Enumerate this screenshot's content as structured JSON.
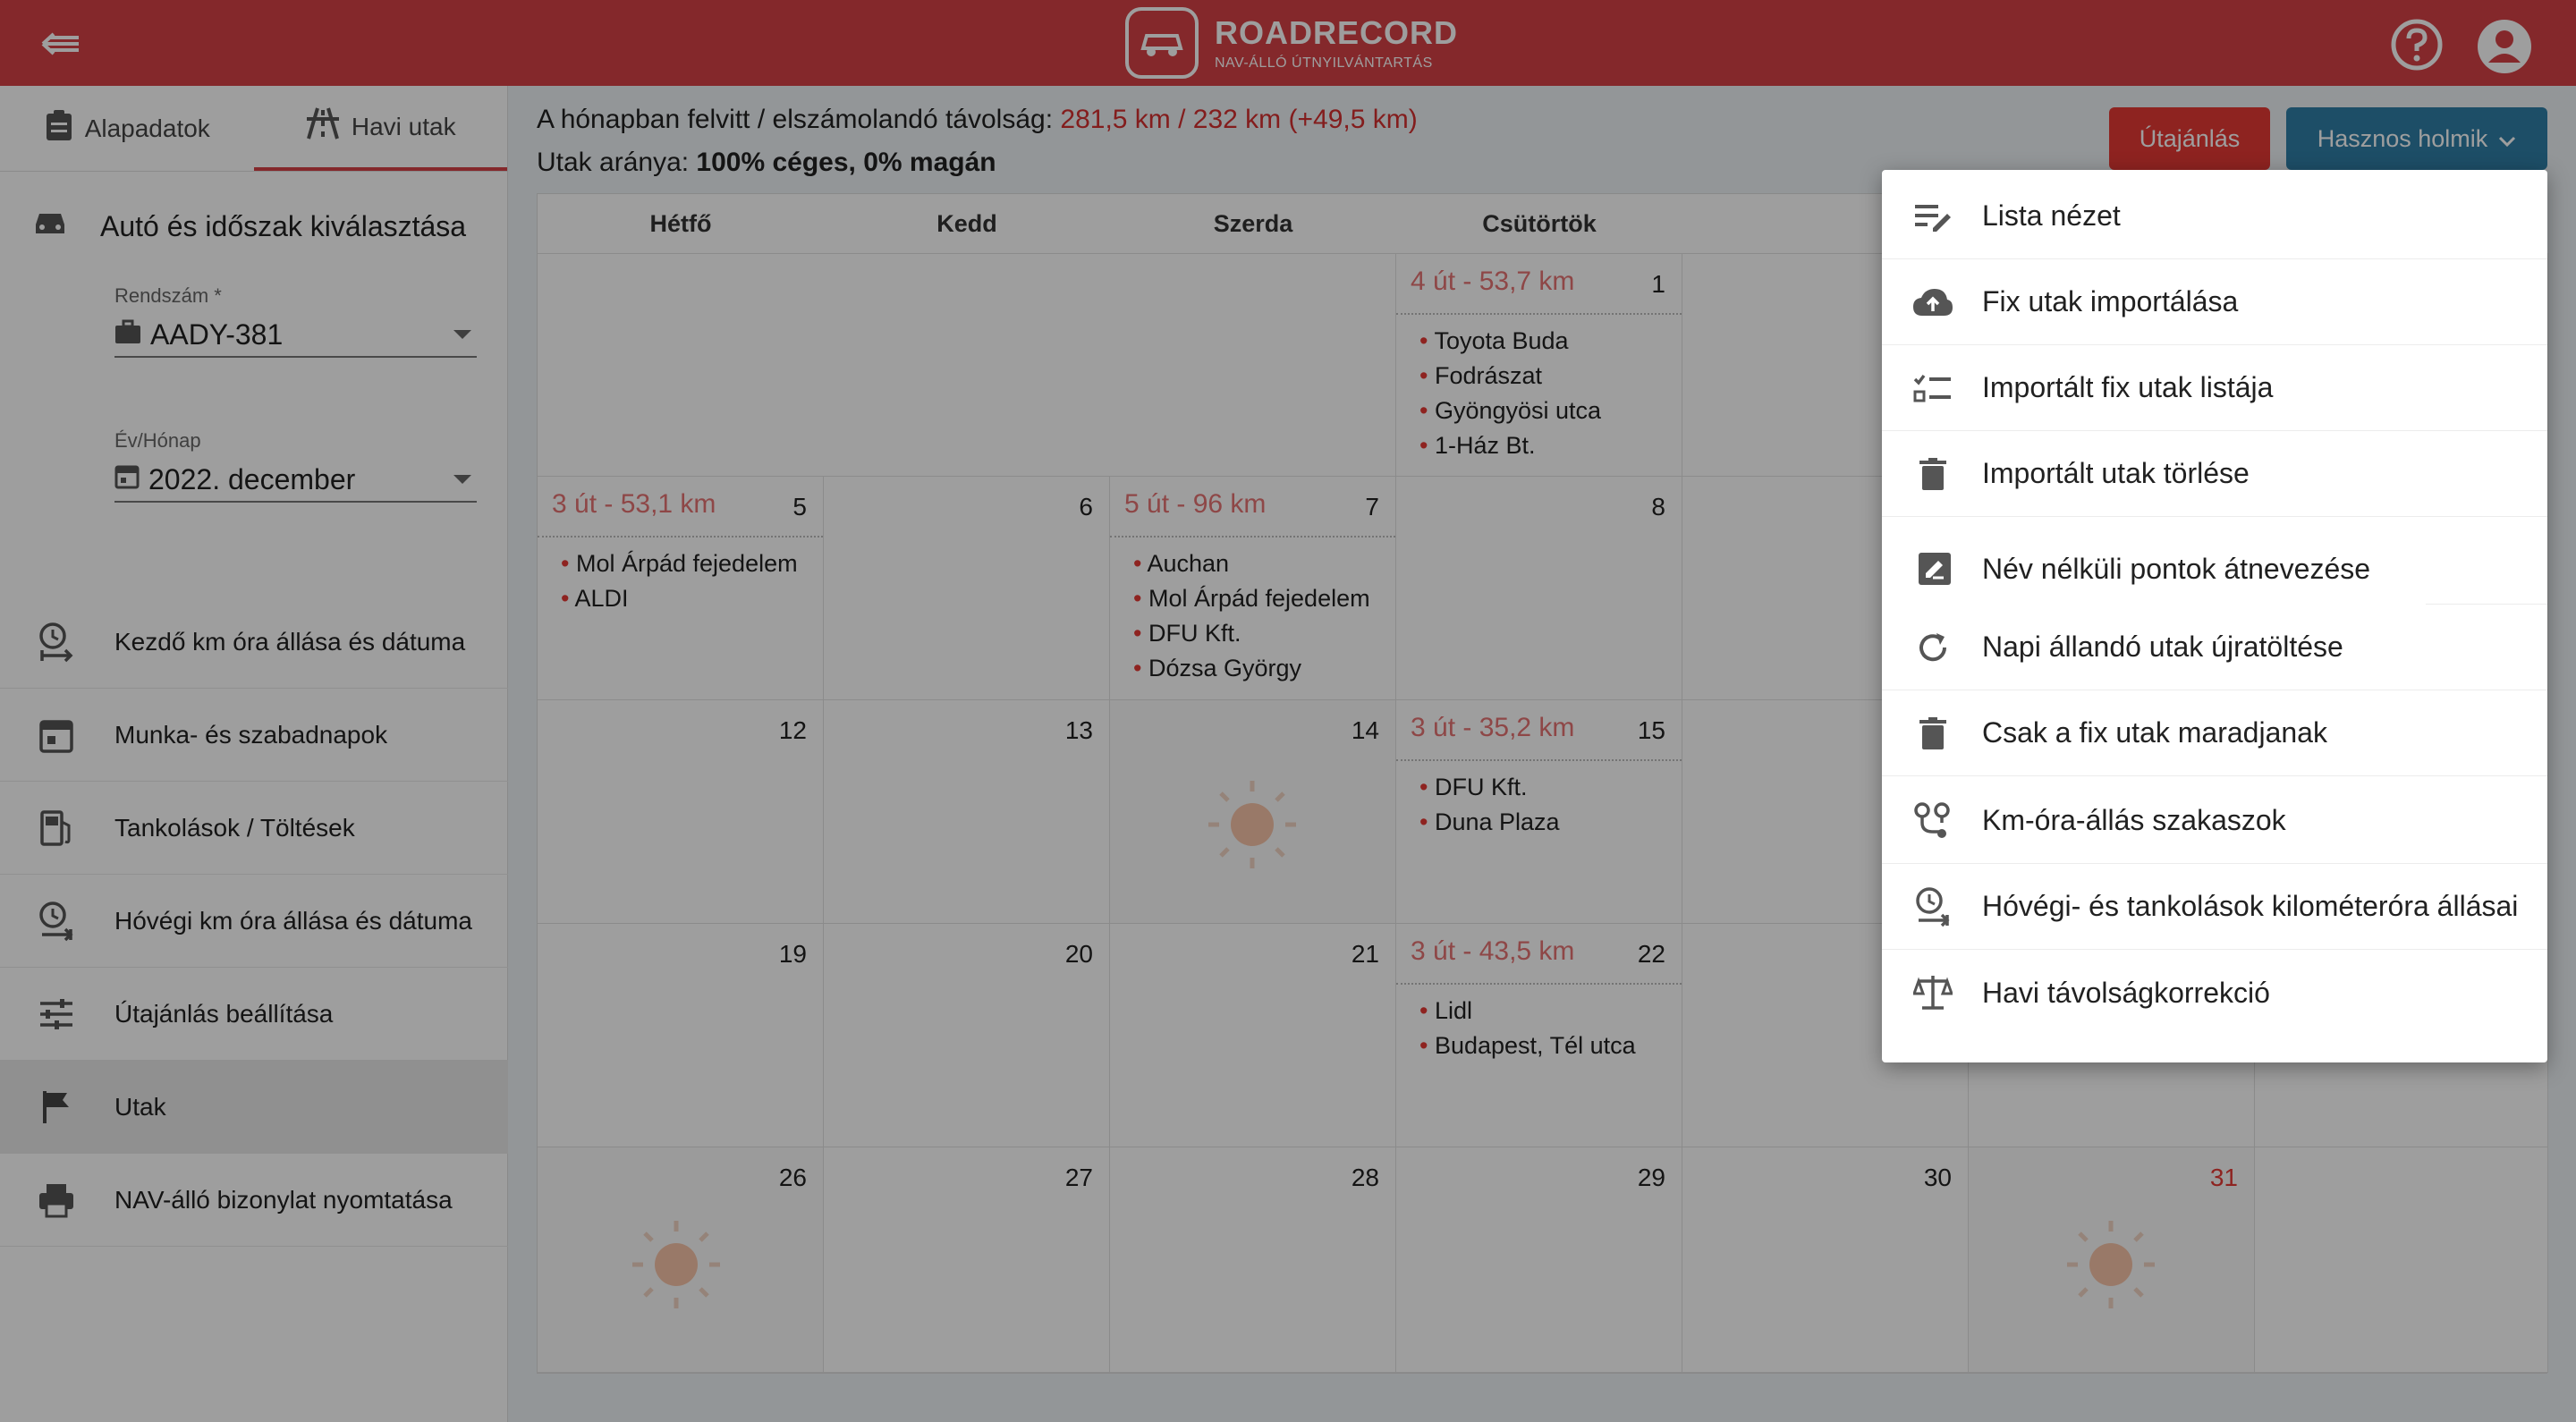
{
  "header": {
    "logo_title": "ROADRECORD",
    "logo_subtitle": "NAV-ÁLLÓ ÚTNYILVÁNTARTÁS"
  },
  "sidebar": {
    "tabs": [
      {
        "label": "Alapadatok"
      },
      {
        "label": "Havi utak"
      }
    ],
    "section_title": "Autó és időszak kiválasztása",
    "plate": {
      "label": "Rendszám *",
      "value": "AADY-381"
    },
    "month": {
      "label": "Év/Hónap",
      "value": "2022. december"
    },
    "items": [
      {
        "label": "Kezdő km óra állása és dátuma"
      },
      {
        "label": "Munka- és szabadnapok"
      },
      {
        "label": "Tankolások / Töltések"
      },
      {
        "label": "Hóvégi km óra állása és dátuma"
      },
      {
        "label": "Útajánlás beállítása"
      },
      {
        "label": "Utak"
      },
      {
        "label": "NAV-álló bizonylat nyomtatása"
      }
    ]
  },
  "summary": {
    "distance_label": "A hónapban felvitt / elszámolandó távolság: ",
    "distance_value": "281,5 km / 232 km (+49,5 km)",
    "ratio_label": "Utak aránya: ",
    "ratio_value": "100% céges, 0% magán"
  },
  "buttons": {
    "route": "Útajánlás",
    "tools": "Hasznos holmik"
  },
  "calendar": {
    "weekdays": [
      "Hétfő",
      "Kedd",
      "Szerda",
      "Csütörtök"
    ],
    "days": {
      "d1": {
        "num": "1",
        "trip": "4 út - 53,7 km",
        "items": [
          "Toyota Buda",
          "Fodrászat",
          "Gyöngyösi utca",
          "1-Ház Bt."
        ]
      },
      "d5": {
        "num": "5",
        "trip": "3 út - 53,1 km",
        "items": [
          "Mol Árpád fejedelem",
          "ALDI"
        ]
      },
      "d6": {
        "num": "6"
      },
      "d7": {
        "num": "7",
        "trip": "5 út - 96 km",
        "items": [
          "Auchan",
          "Mol Árpád fejedelem",
          "DFU Kft.",
          "Dózsa György"
        ]
      },
      "d8": {
        "num": "8"
      },
      "d12": {
        "num": "12"
      },
      "d13": {
        "num": "13"
      },
      "d14": {
        "num": "14"
      },
      "d15": {
        "num": "15",
        "trip": "3 út - 35,2 km",
        "items": [
          "DFU Kft.",
          "Duna Plaza"
        ]
      },
      "d19": {
        "num": "19"
      },
      "d20": {
        "num": "20"
      },
      "d21": {
        "num": "21"
      },
      "d22": {
        "num": "22",
        "trip": "3 út - 43,5 km",
        "items": [
          "Lidl",
          "Budapest, Tél utca"
        ]
      },
      "d26": {
        "num": "26"
      },
      "d27": {
        "num": "27"
      },
      "d28": {
        "num": "28"
      },
      "d29": {
        "num": "29"
      },
      "d30": {
        "num": "30"
      },
      "d31": {
        "num": "31"
      }
    }
  },
  "menu": {
    "items": [
      {
        "label": "Lista nézet"
      },
      {
        "label": "Fix utak importálása"
      },
      {
        "label": "Importált fix utak listája"
      },
      {
        "label": "Importált utak törlése"
      },
      {
        "label": "Név nélküli pontok átnevezése"
      },
      {
        "label": "Napi állandó utak újratöltése"
      },
      {
        "label": "Csak a fix utak maradjanak"
      },
      {
        "label": "Km-óra-állás szakaszok"
      },
      {
        "label": "Hóvégi- és tankolások kilométeróra állásai"
      },
      {
        "label": "Havi távolságkorrekció"
      }
    ]
  },
  "colors": {
    "brand": "#d64146",
    "accent": "#2f7fa7",
    "trip": "#e57373"
  }
}
